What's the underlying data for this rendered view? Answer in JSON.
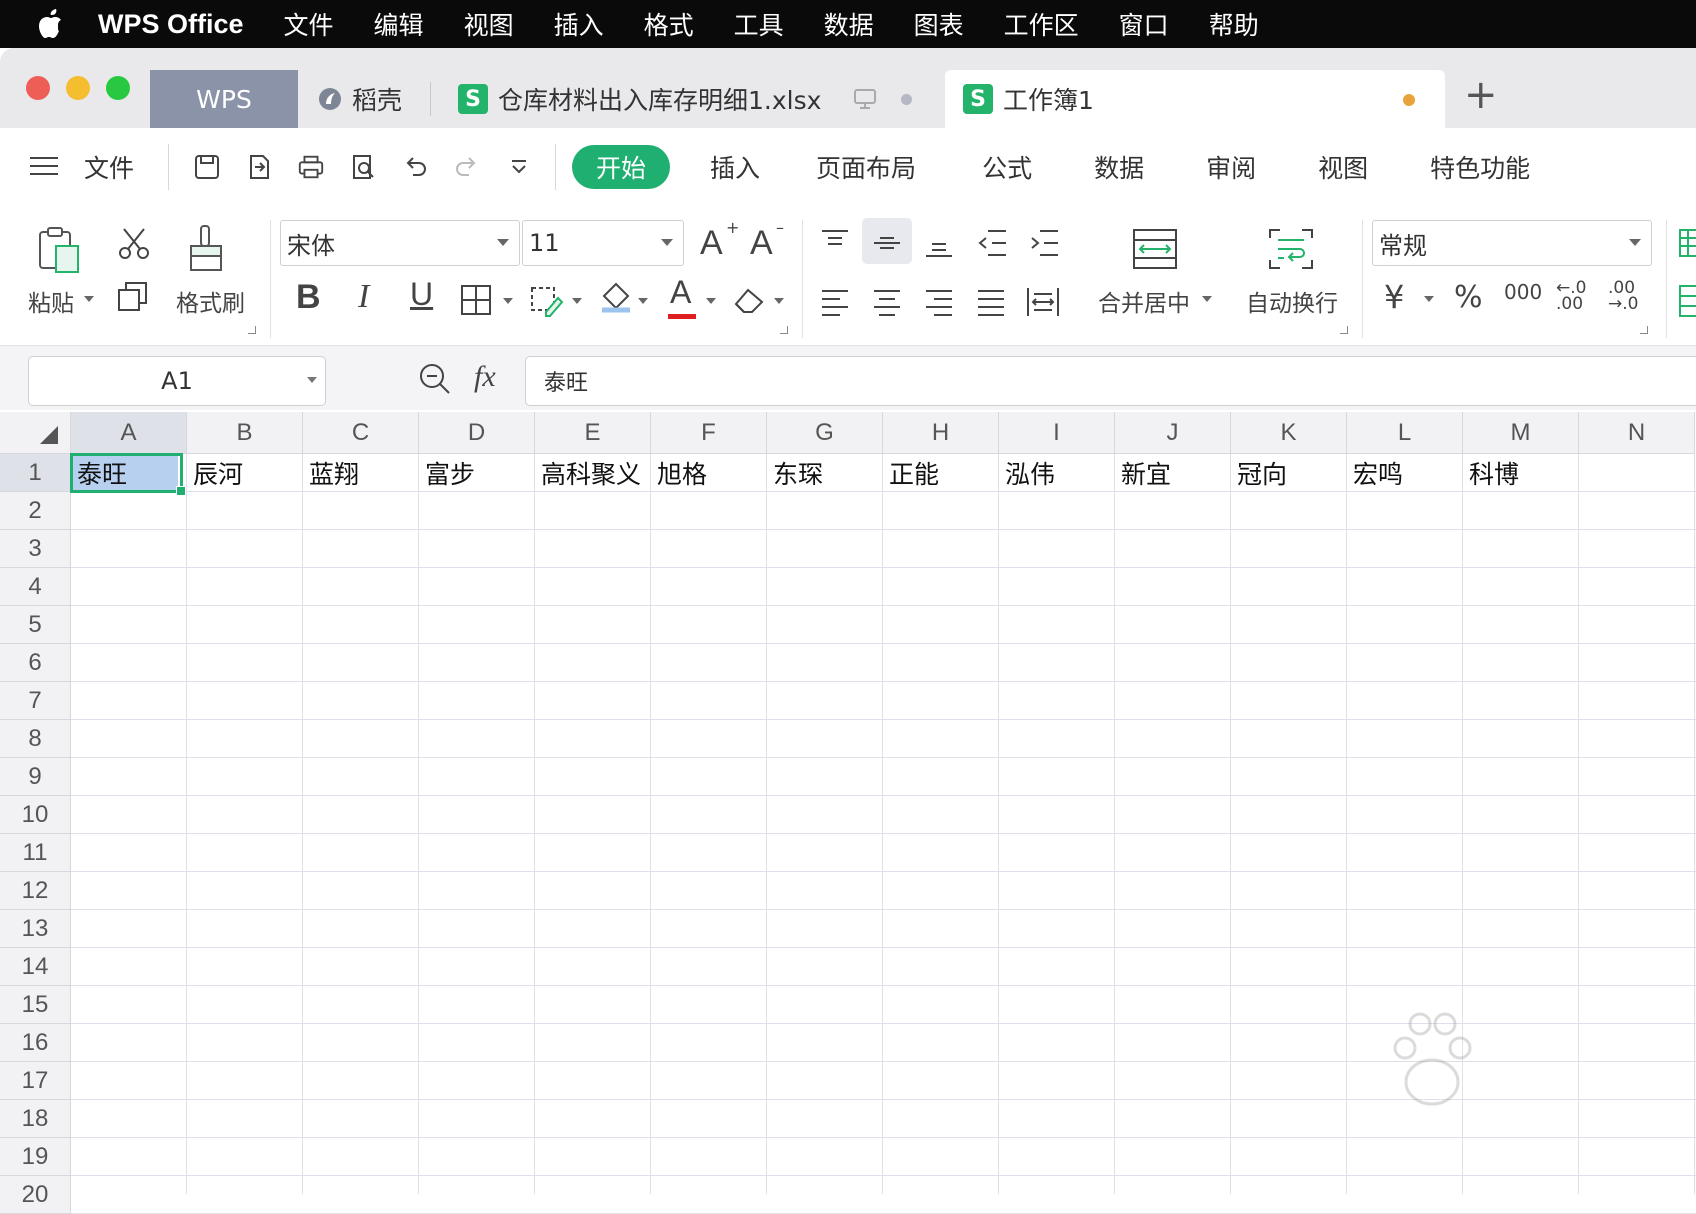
{
  "menubar": {
    "app_name": "WPS Office",
    "items": [
      "文件",
      "编辑",
      "视图",
      "插入",
      "格式",
      "工具",
      "数据",
      "图表",
      "工作区",
      "窗口",
      "帮助"
    ]
  },
  "tabs": {
    "wps": "WPS",
    "daoke": "稻壳",
    "file1": "仓库材料出入库存明细1.xlsx",
    "active": "工作簿1",
    "s_letter": "S",
    "add": "+"
  },
  "menu": {
    "file": "文件",
    "start": "开始",
    "items": [
      "插入",
      "页面布局",
      "公式",
      "数据",
      "审阅",
      "视图",
      "特色功能"
    ]
  },
  "ribbon": {
    "paste": "粘贴",
    "format_painter": "格式刷",
    "font_name": "宋体",
    "font_size": "11",
    "merge_center": "合并居中",
    "auto_wrap": "自动换行",
    "number_format": "常规",
    "bold": "B",
    "italic": "I",
    "underline": "U",
    "font_color": "A",
    "grow": "A",
    "shrink": "A",
    "yen": "¥",
    "percent": "%",
    "thousands": "000",
    "inc_decimal": ".00",
    "dec_decimal": ".0"
  },
  "formula_bar": {
    "name_box": "A1",
    "fx": "fx",
    "content": "泰旺"
  },
  "sheet": {
    "columns": [
      "A",
      "B",
      "C",
      "D",
      "E",
      "F",
      "G",
      "H",
      "I",
      "J",
      "K",
      "L",
      "M",
      "N"
    ],
    "rows": [
      "1",
      "2",
      "3",
      "4",
      "5",
      "6",
      "7",
      "8",
      "9",
      "10",
      "11",
      "12",
      "13",
      "14",
      "15",
      "16",
      "17",
      "18",
      "19",
      "20"
    ],
    "row1": [
      "泰旺",
      "辰河",
      "蓝翔",
      "富步",
      "高科聚义",
      "旭格",
      "东琛",
      "正能",
      "泓伟",
      "新宜",
      "冠向",
      "宏鸣",
      "科博",
      ""
    ]
  },
  "colors": {
    "accent": "#1fb071",
    "selection_fill": "#b7d0ef",
    "menubar_bg": "#0a0a0a"
  }
}
